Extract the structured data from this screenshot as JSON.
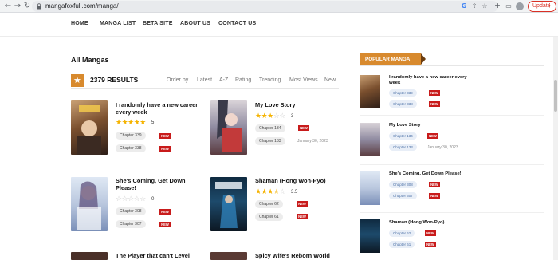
{
  "browser": {
    "url": "mangafoxfull.com/manga/",
    "update_label": "Update"
  },
  "nav": [
    "HOME",
    "MANGA LIST",
    "BETA SITE",
    "ABOUT US",
    "CONTACT US"
  ],
  "main": {
    "title": "All Mangas",
    "results": "2379 RESULTS",
    "sort_options": [
      "Order by",
      "Latest",
      "A-Z",
      "Rating",
      "Trending",
      "Most Views",
      "New"
    ]
  },
  "manga": [
    {
      "title": "I randomly have a new career every week",
      "rating": "5",
      "stars": 5,
      "chapters": [
        {
          "label": "Chapter 339",
          "badge": "NEW"
        },
        {
          "label": "Chapter 338",
          "badge": "NEW"
        }
      ]
    },
    {
      "title": "My Love Story",
      "rating": "3",
      "stars": 3,
      "chapters": [
        {
          "label": "Chapter 134",
          "badge": "NEW"
        },
        {
          "label": "Chapter 133",
          "date": "January 30, 2023"
        }
      ]
    },
    {
      "title": "She's Coming, Get Down Please!",
      "rating": "0",
      "stars": 0,
      "chapters": [
        {
          "label": "Chapter 308",
          "badge": "NEW"
        },
        {
          "label": "Chapter 307",
          "badge": "NEW"
        }
      ]
    },
    {
      "title": "Shaman (Hong Won-Pyo)",
      "rating": "3.5",
      "stars": 3.5,
      "chapters": [
        {
          "label": "Chapter 62",
          "badge": "NEW"
        },
        {
          "label": "Chapter 61",
          "badge": "NEW"
        }
      ]
    },
    {
      "title": "The Player that can't Level"
    },
    {
      "title": "Spicy Wife's Reborn World"
    }
  ],
  "sidebar": {
    "header": "POPULAR MANGA",
    "items": [
      {
        "title": "I randomly have a new career every week",
        "chapters": [
          {
            "label": "Chapter 339",
            "badge": "NEW"
          },
          {
            "label": "Chapter 338",
            "badge": "NEW"
          }
        ]
      },
      {
        "title": "My Love Story",
        "chapters": [
          {
            "label": "Chapter 134",
            "badge": "NEW"
          },
          {
            "label": "Chapter 133",
            "date": "January 30, 2023"
          }
        ]
      },
      {
        "title": "She's Coming, Get Down Please!",
        "chapters": [
          {
            "label": "Chapter 308",
            "badge": "NEW"
          },
          {
            "label": "Chapter 307",
            "badge": "NEW"
          }
        ]
      },
      {
        "title": "Shaman (Hong Won-Pyo)",
        "chapters": [
          {
            "label": "Chapter 62",
            "badge": "NEW"
          },
          {
            "label": "Chapter 61",
            "badge": "NEW"
          }
        ]
      }
    ]
  },
  "colors": {
    "accent": "#d88a2e",
    "new_badge": "#c81b1b",
    "star": "#f5b301",
    "sidebar_chip_text": "#4a6fa5"
  }
}
